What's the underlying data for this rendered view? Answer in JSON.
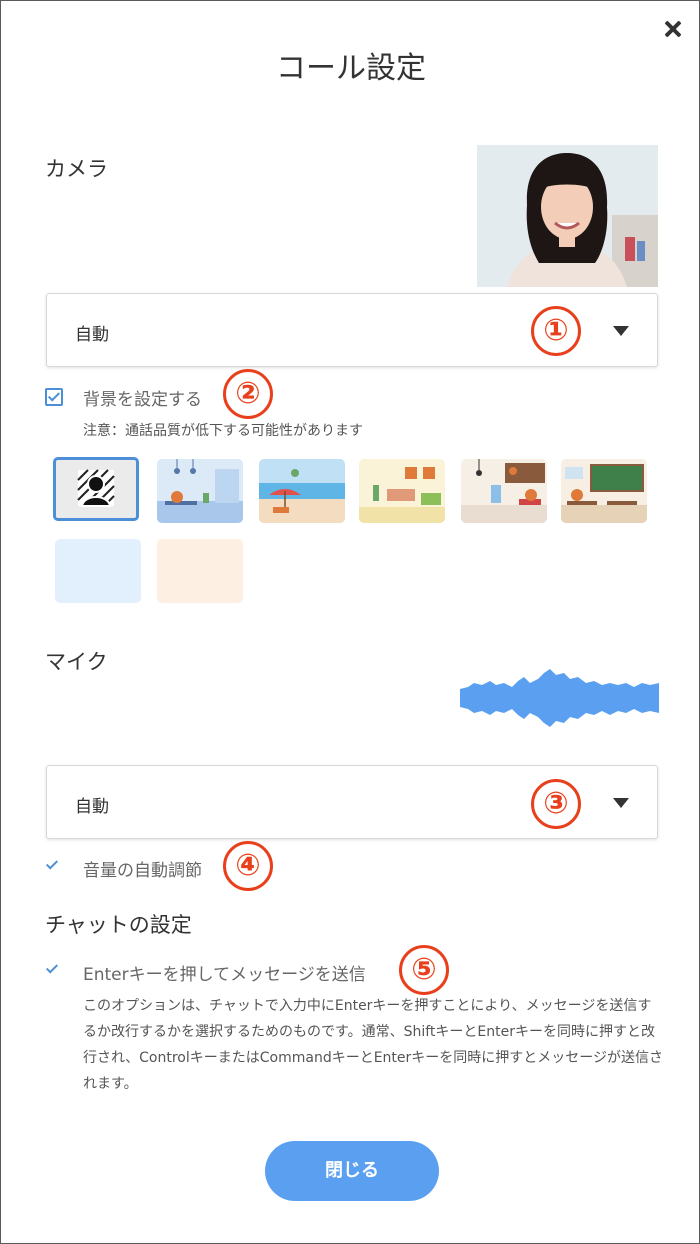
{
  "dialog": {
    "title": "コール設定",
    "close_label": "×"
  },
  "camera": {
    "label": "カメラ",
    "device": {
      "selected": "自動"
    },
    "background": {
      "checked": true,
      "label": "背景を設定する",
      "note": "注意：通話品質が低下する可能性があります"
    }
  },
  "mic": {
    "label": "マイク",
    "device": {
      "selected": "自動"
    },
    "auto_gain": {
      "checked": true,
      "label": "音量の自動調節"
    }
  },
  "chat": {
    "label": "チャットの設定",
    "enter_send": {
      "checked": true,
      "label": "Enterキーを押してメッセージを送信",
      "description": "このオプションは、チャットで入力中にEnterキーを押すことにより、メッセージを送信するか改行するかを選択するためのものです。通常、ShiftキーとEnterキーを同時に押すと改行され、ControlキーまたはCommandキーとEnterキーを同時に押すとメッセージが送信されます。"
    }
  },
  "annotations": [
    "①",
    "②",
    "③",
    "④",
    "⑤"
  ],
  "footer": {
    "close_button": "閉じる"
  },
  "colors": {
    "accent": "#5ba0f0",
    "annotation": "#e8401c",
    "checkbox": "#4a8fd8"
  }
}
